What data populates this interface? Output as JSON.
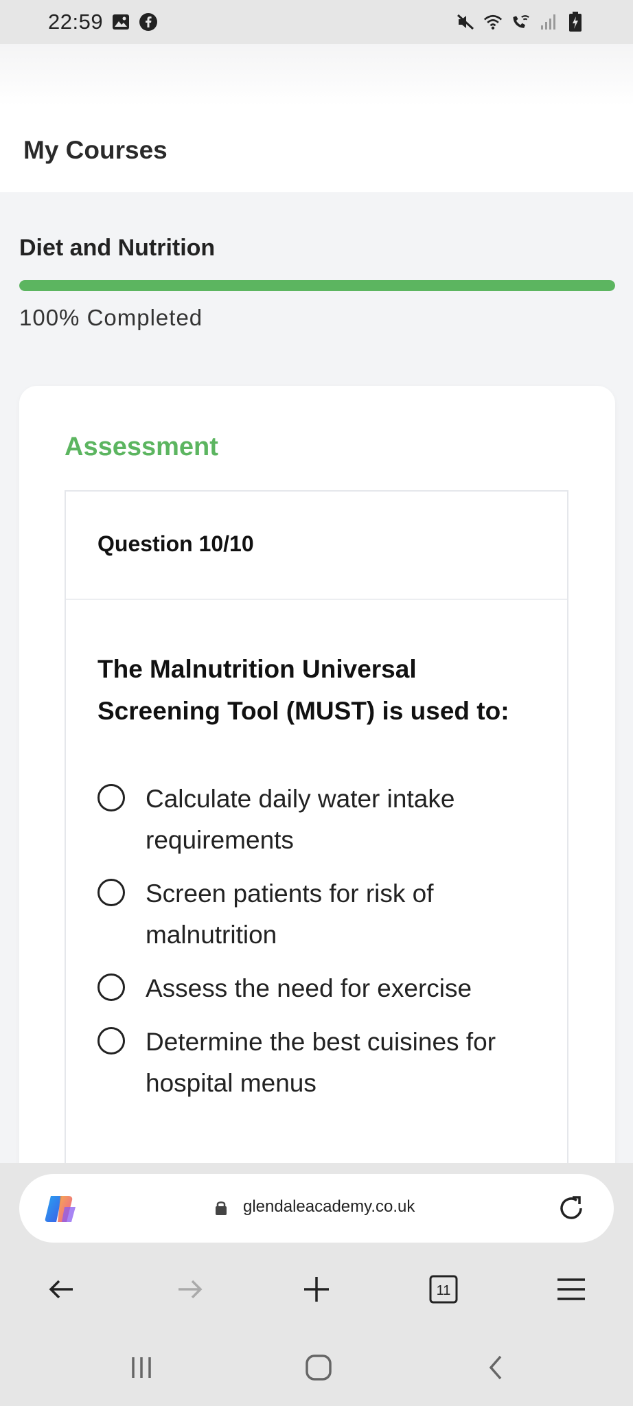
{
  "status_bar": {
    "time": "22:59",
    "left_icons": [
      "gallery-icon",
      "facebook-icon"
    ],
    "right_icons": [
      "mute-icon",
      "wifi-icon",
      "wifi-calling-icon",
      "signal-icon",
      "battery-charging-icon"
    ]
  },
  "header": {
    "title": "My Courses"
  },
  "course": {
    "title": "Diet and Nutrition",
    "progress_percent": 100,
    "progress_label": "100% Completed",
    "accent_color": "#5cb560"
  },
  "assessment": {
    "label": "Assessment",
    "question_number": "Question 10/10",
    "question_text": "The Malnutrition Universal Screening Tool (MUST) is used to:",
    "options": [
      "Calculate daily water intake requirements",
      "Screen patients for risk of malnutrition",
      "Assess the need for exercise",
      "Determine the best cuisines for hospital menus"
    ]
  },
  "browser": {
    "url": "glendaleacademy.co.uk",
    "tab_count": "11",
    "nav_icons": [
      "back-arrow-icon",
      "forward-arrow-icon",
      "new-tab-plus-icon",
      "tab-switcher-icon",
      "menu-icon"
    ]
  },
  "system_nav": [
    "recent-apps-icon",
    "home-icon",
    "back-icon"
  ]
}
